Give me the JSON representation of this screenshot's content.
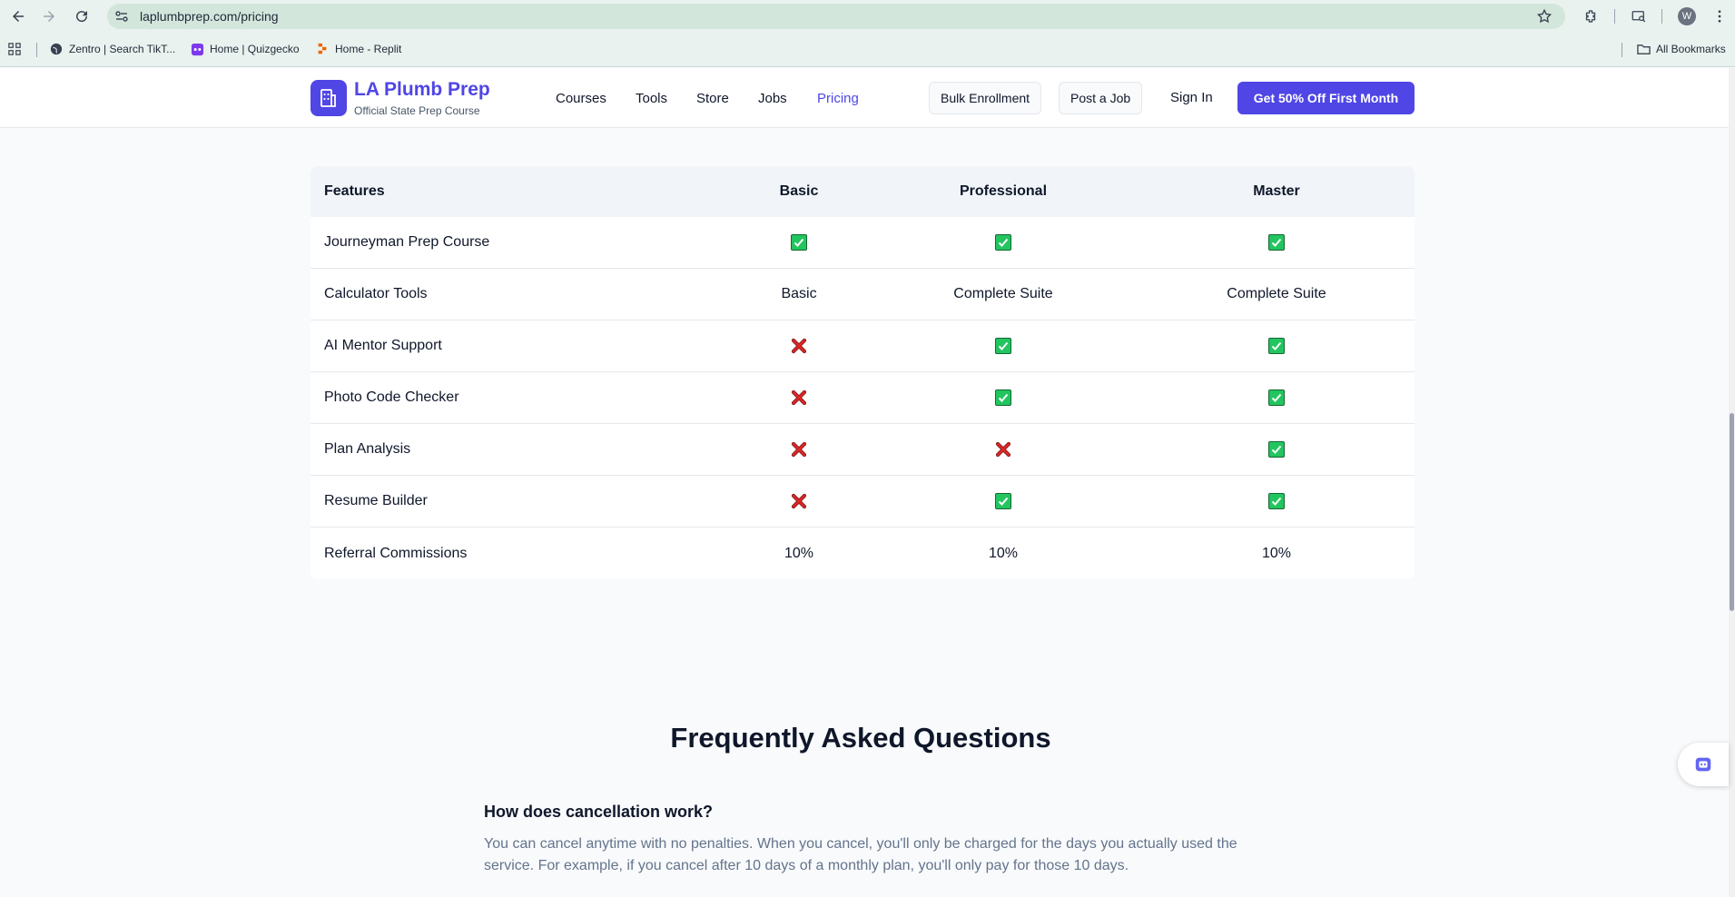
{
  "browser": {
    "url": "laplumbprep.com/pricing",
    "avatar_letter": "W",
    "bookmarks": [
      {
        "label": "Zentro | Search TikT..."
      },
      {
        "label": "Home | Quizgecko"
      },
      {
        "label": "Home - Replit"
      }
    ],
    "all_bookmarks_label": "All Bookmarks"
  },
  "header": {
    "brand_title": "LA Plumb Prep",
    "brand_subtitle": "Official State Prep Course",
    "nav": [
      "Courses",
      "Tools",
      "Store",
      "Jobs",
      "Pricing"
    ],
    "active_nav": "Pricing",
    "bulk_enrollment": "Bulk Enrollment",
    "post_job": "Post a Job",
    "sign_in": "Sign In",
    "cta": "Get 50% Off First Month",
    "accent_color": "#4f46e5"
  },
  "comparison": {
    "headers": [
      "Features",
      "Basic",
      "Professional",
      "Master"
    ],
    "rows": [
      {
        "feature": "Journeyman Prep Course",
        "values": [
          "check",
          "check",
          "check"
        ]
      },
      {
        "feature": "Calculator Tools",
        "values": [
          "Basic",
          "Complete Suite",
          "Complete Suite"
        ]
      },
      {
        "feature": "AI Mentor Support",
        "values": [
          "cross",
          "check",
          "check"
        ]
      },
      {
        "feature": "Photo Code Checker",
        "values": [
          "cross",
          "check",
          "check"
        ]
      },
      {
        "feature": "Plan Analysis",
        "values": [
          "cross",
          "cross",
          "check"
        ]
      },
      {
        "feature": "Resume Builder",
        "values": [
          "cross",
          "check",
          "check"
        ]
      },
      {
        "feature": "Referral Commissions",
        "values": [
          "10%",
          "10%",
          "10%"
        ]
      }
    ]
  },
  "faq": {
    "title": "Frequently Asked Questions",
    "items": [
      {
        "question": "How does cancellation work?",
        "answer": "You can cancel anytime with no penalties. When you cancel, you'll only be charged for the days you actually used the service. For example, if you cancel after 10 days of a monthly plan, you'll only pay for those 10 days."
      }
    ]
  }
}
